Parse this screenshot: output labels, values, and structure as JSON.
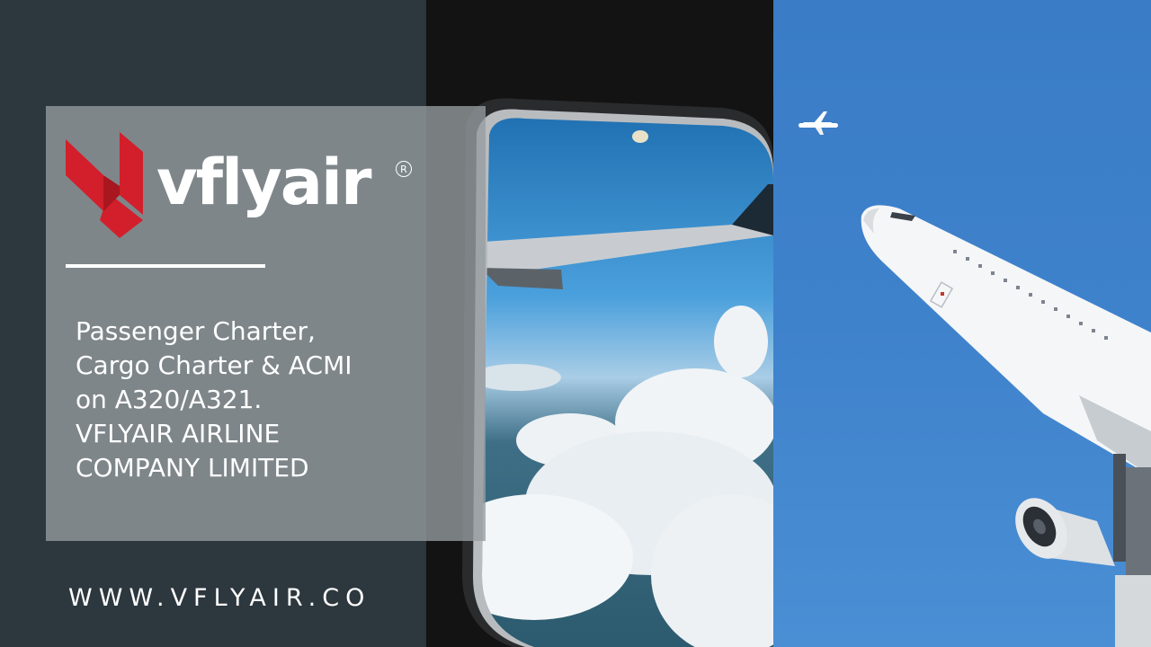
{
  "brand": {
    "name": "vflyair",
    "registered_mark": "R",
    "logo_color": "#d21f2b"
  },
  "tagline": {
    "lines": [
      "Passenger Charter,",
      "Cargo Charter & ACMI",
      "on A320/A321.",
      "VFLYAIR AIRLINE",
      "COMPANY LIMITED"
    ]
  },
  "website": "WWW.VFLYAIR.CO",
  "images": {
    "window_view": "airplane-window-view-over-clouds",
    "sky_plane": "airplane-fuselage-in-blue-sky"
  },
  "colors": {
    "background": "#2c373e",
    "card": "#969ca0",
    "sky": "#3f82cc",
    "text": "#ffffff"
  }
}
